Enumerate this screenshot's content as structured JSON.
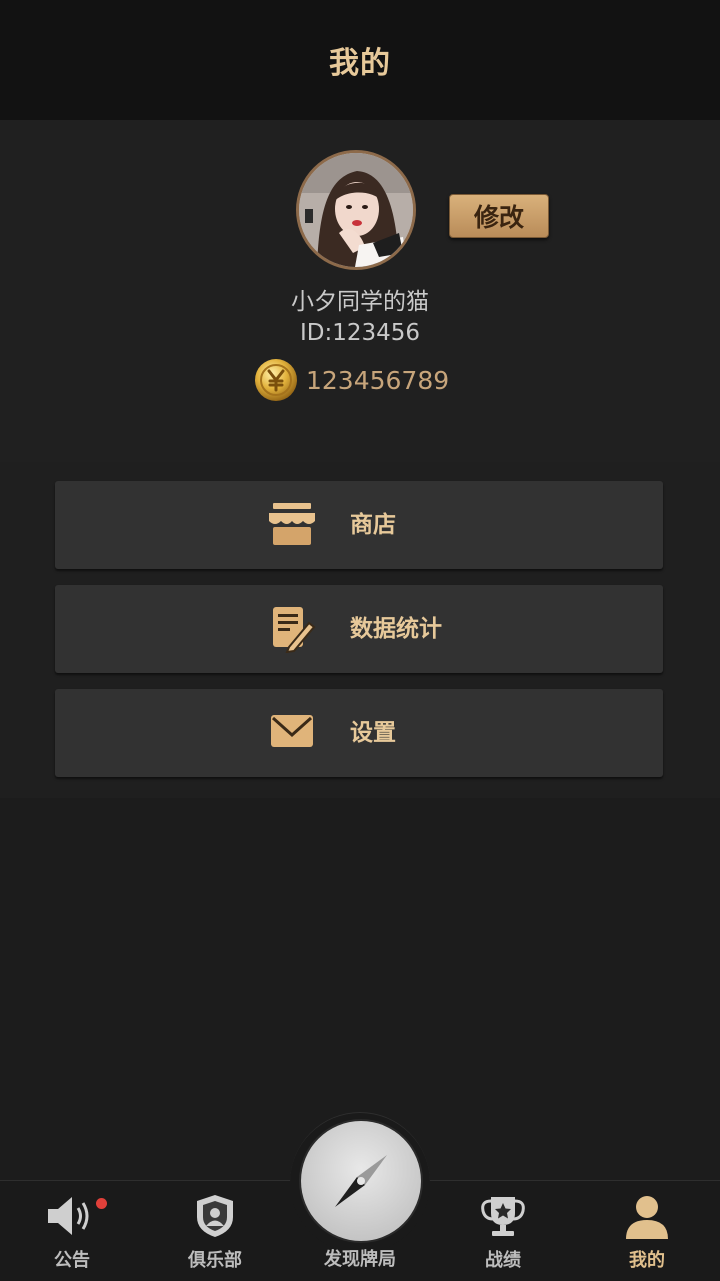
{
  "header": {
    "title": "我的"
  },
  "profile": {
    "nickname": "小夕同学的猫",
    "id_text": "ID:123456",
    "coins": "123456789",
    "edit_label": "修改"
  },
  "menu": {
    "items": [
      {
        "label": "商店",
        "icon": "shop-icon"
      },
      {
        "label": "数据统计",
        "icon": "edit-document-icon"
      },
      {
        "label": "设置",
        "icon": "envelope-icon"
      }
    ]
  },
  "bottom_nav": {
    "items": [
      {
        "label": "公告",
        "icon": "speaker-icon"
      },
      {
        "label": "俱乐部",
        "icon": "club-shield-icon"
      },
      {
        "label": "发现牌局",
        "icon": "compass-icon"
      },
      {
        "label": "战绩",
        "icon": "trophy-icon"
      },
      {
        "label": "我的",
        "icon": "user-icon",
        "active": true
      }
    ]
  },
  "colors": {
    "accent_gold": "#e7c99a",
    "background": "#1c1c1c",
    "notification": "#e0403a"
  }
}
